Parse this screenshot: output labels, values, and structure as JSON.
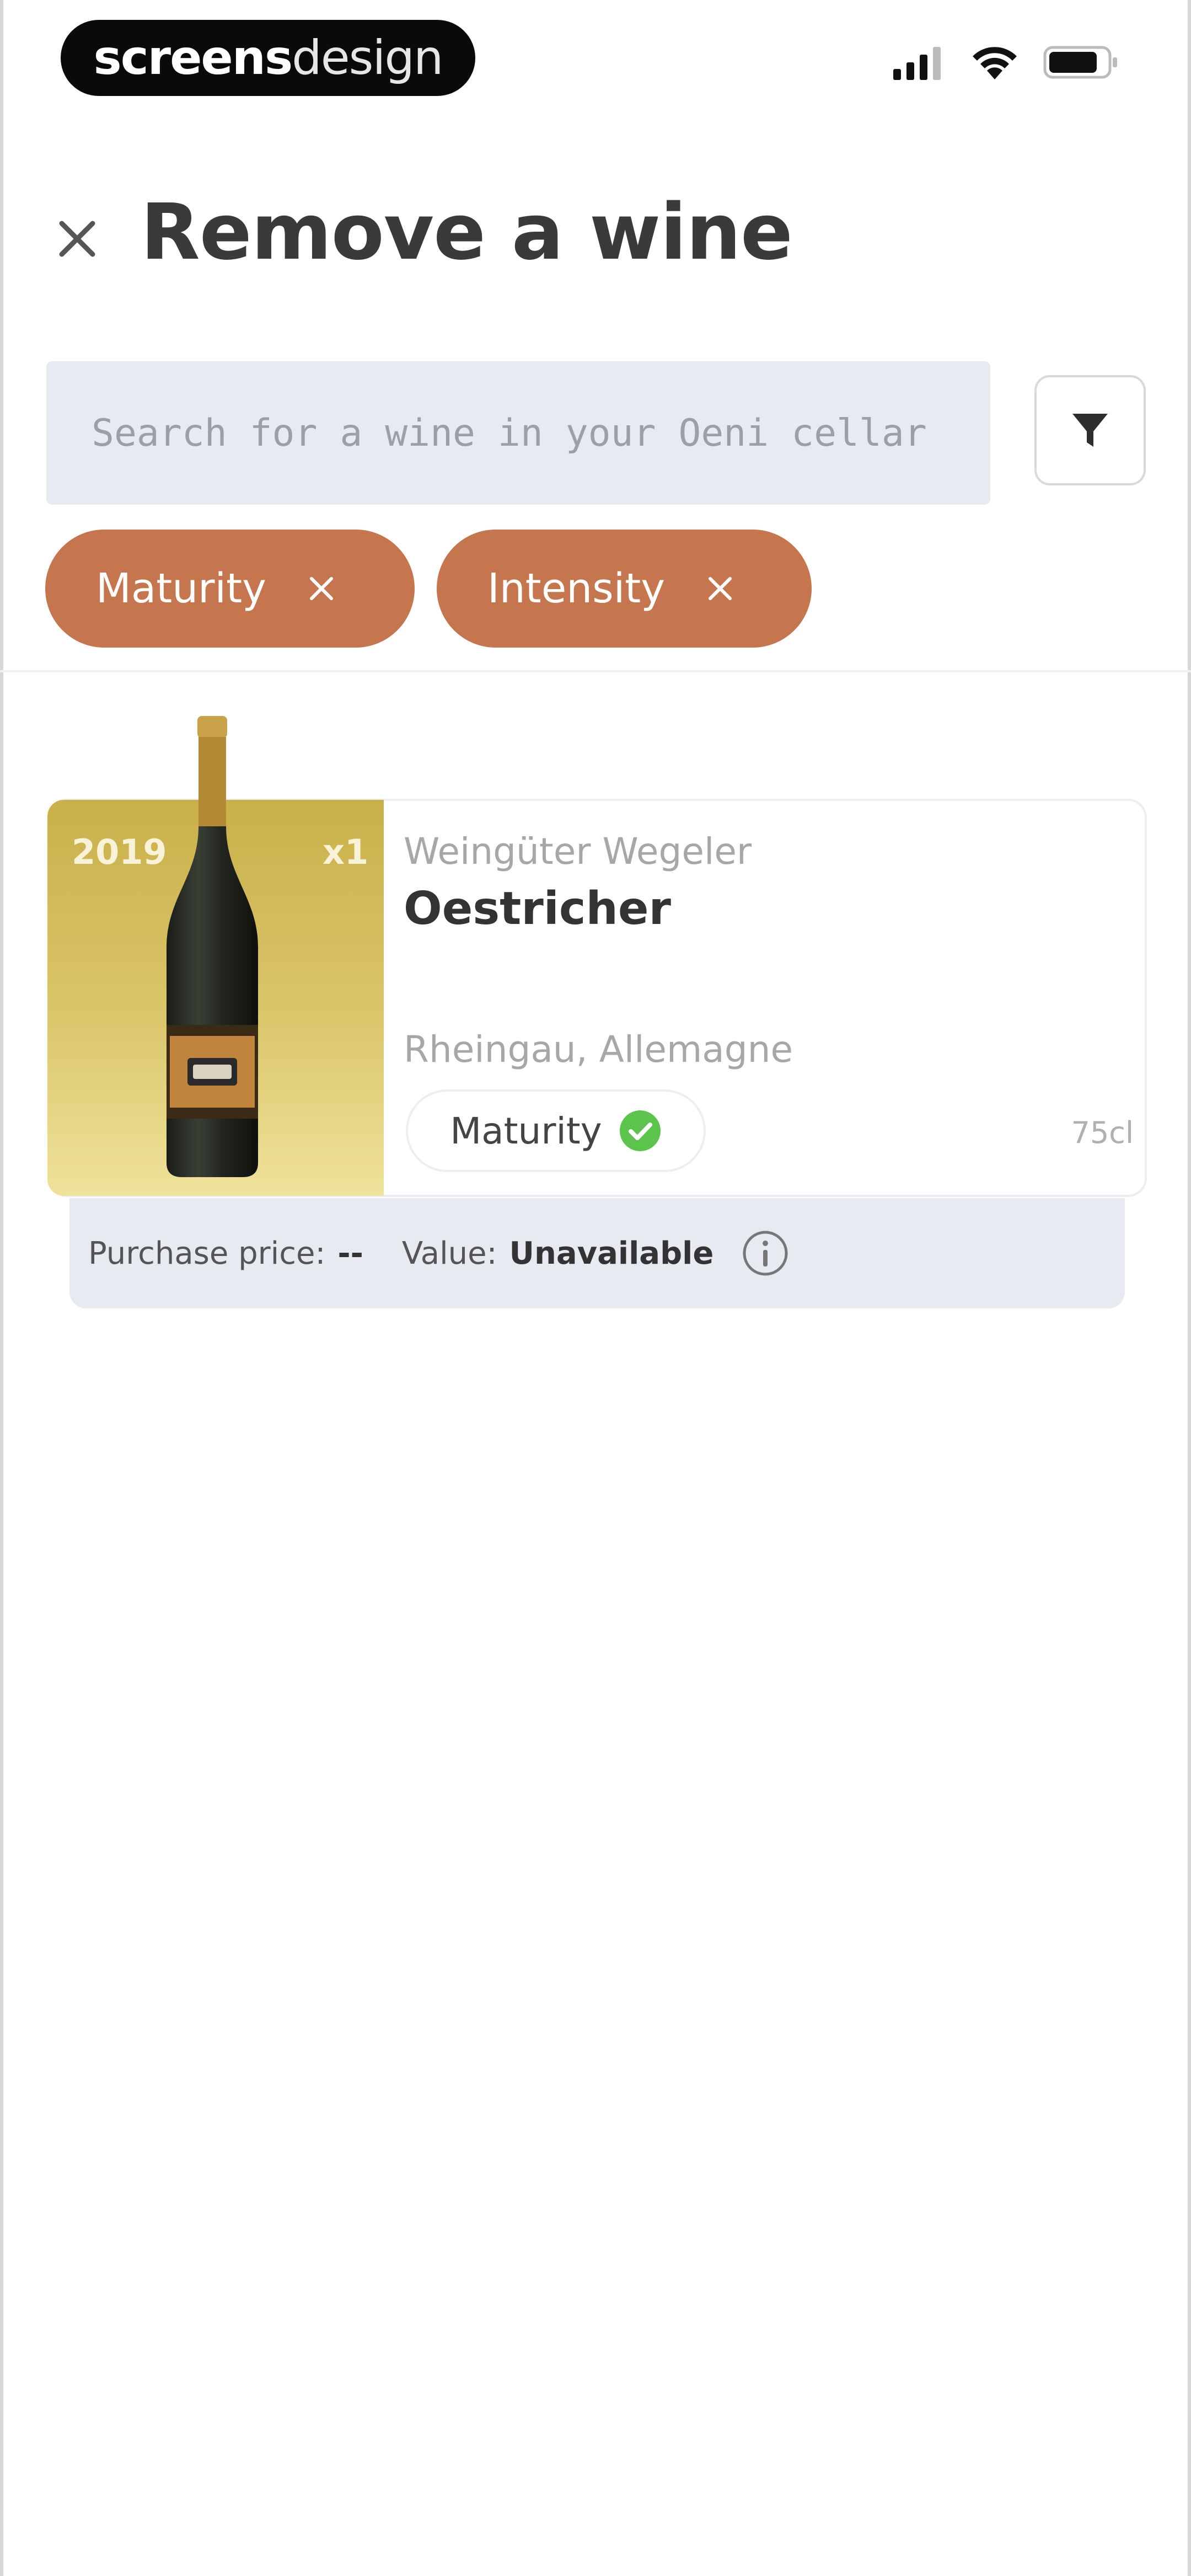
{
  "brand": {
    "bold": "screens",
    "light": "design"
  },
  "header": {
    "title": "Remove a wine"
  },
  "search": {
    "placeholder": "Search for a wine in your Oeni cellar"
  },
  "filters": [
    {
      "label": "Maturity"
    },
    {
      "label": "Intensity"
    }
  ],
  "wine": {
    "vintage": "2019",
    "quantity": "x1",
    "producer": "Weingüter Wegeler",
    "name": "Oestricher",
    "region": "Rheingau, Allemagne",
    "badge": "Maturity",
    "volume": "75cl",
    "purchase_label": "Purchase price:",
    "purchase_value": "--",
    "value_label": "Value:",
    "value_value": "Unavailable"
  },
  "colors": {
    "chip": "#c5764e",
    "search_bg": "#e7eaf1",
    "card_image_top": "#c9b04a",
    "card_image_bottom": "#efe29b",
    "badge_check": "#5cc34d"
  },
  "icons": [
    "signal-icon",
    "wifi-icon",
    "battery-icon",
    "close-icon",
    "filter-icon",
    "chip-remove-icon",
    "check-circle-icon",
    "info-icon",
    "wine-bottle-image"
  ]
}
